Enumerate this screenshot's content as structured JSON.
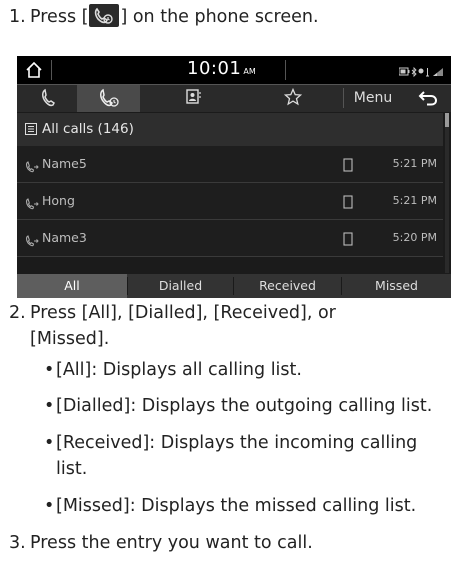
{
  "steps": [
    {
      "num": "1.",
      "before": "Press [",
      "after": "] on the phone screen.",
      "icon": "call-history-icon"
    },
    {
      "num": "2.",
      "line1": "Press [All], [Dialled], [Received], or",
      "line2": "[Missed]."
    },
    {
      "num": "3.",
      "text": "Press the entry you want to call."
    }
  ],
  "bullets": [
    {
      "line1": "[All]: Displays all calling list."
    },
    {
      "line1": "[Dialled]: Displays the outgoing calling list."
    },
    {
      "line1": "[Received]: Displays the incoming calling",
      "line2": "list."
    },
    {
      "line1": "[Missed]: Displays the missed calling list."
    }
  ],
  "screen": {
    "status": {
      "time": "10:01",
      "ampm": "AM"
    },
    "tabs": [
      {
        "icon": "handset-icon",
        "active": false
      },
      {
        "icon": "call-history-icon",
        "active": true
      },
      {
        "icon": "contacts-icon",
        "active": false
      },
      {
        "icon": "star-icon",
        "active": false
      }
    ],
    "menu_label": "Menu",
    "list_header": "All calls (146)",
    "calls": [
      {
        "name": "Name5",
        "time": "5:21 PM"
      },
      {
        "name": "Hong",
        "time": "5:21 PM"
      },
      {
        "name": "Name3",
        "time": "5:20 PM"
      }
    ],
    "filters": [
      {
        "label": "All",
        "active": true
      },
      {
        "label": "Dialled",
        "active": false
      },
      {
        "label": "Received",
        "active": false
      },
      {
        "label": "Missed",
        "active": false
      }
    ],
    "colors": {
      "screen_bg": "#1b1b1b",
      "active_tab": "#4a4a4a",
      "active_filter": "#5e5e5e"
    }
  }
}
